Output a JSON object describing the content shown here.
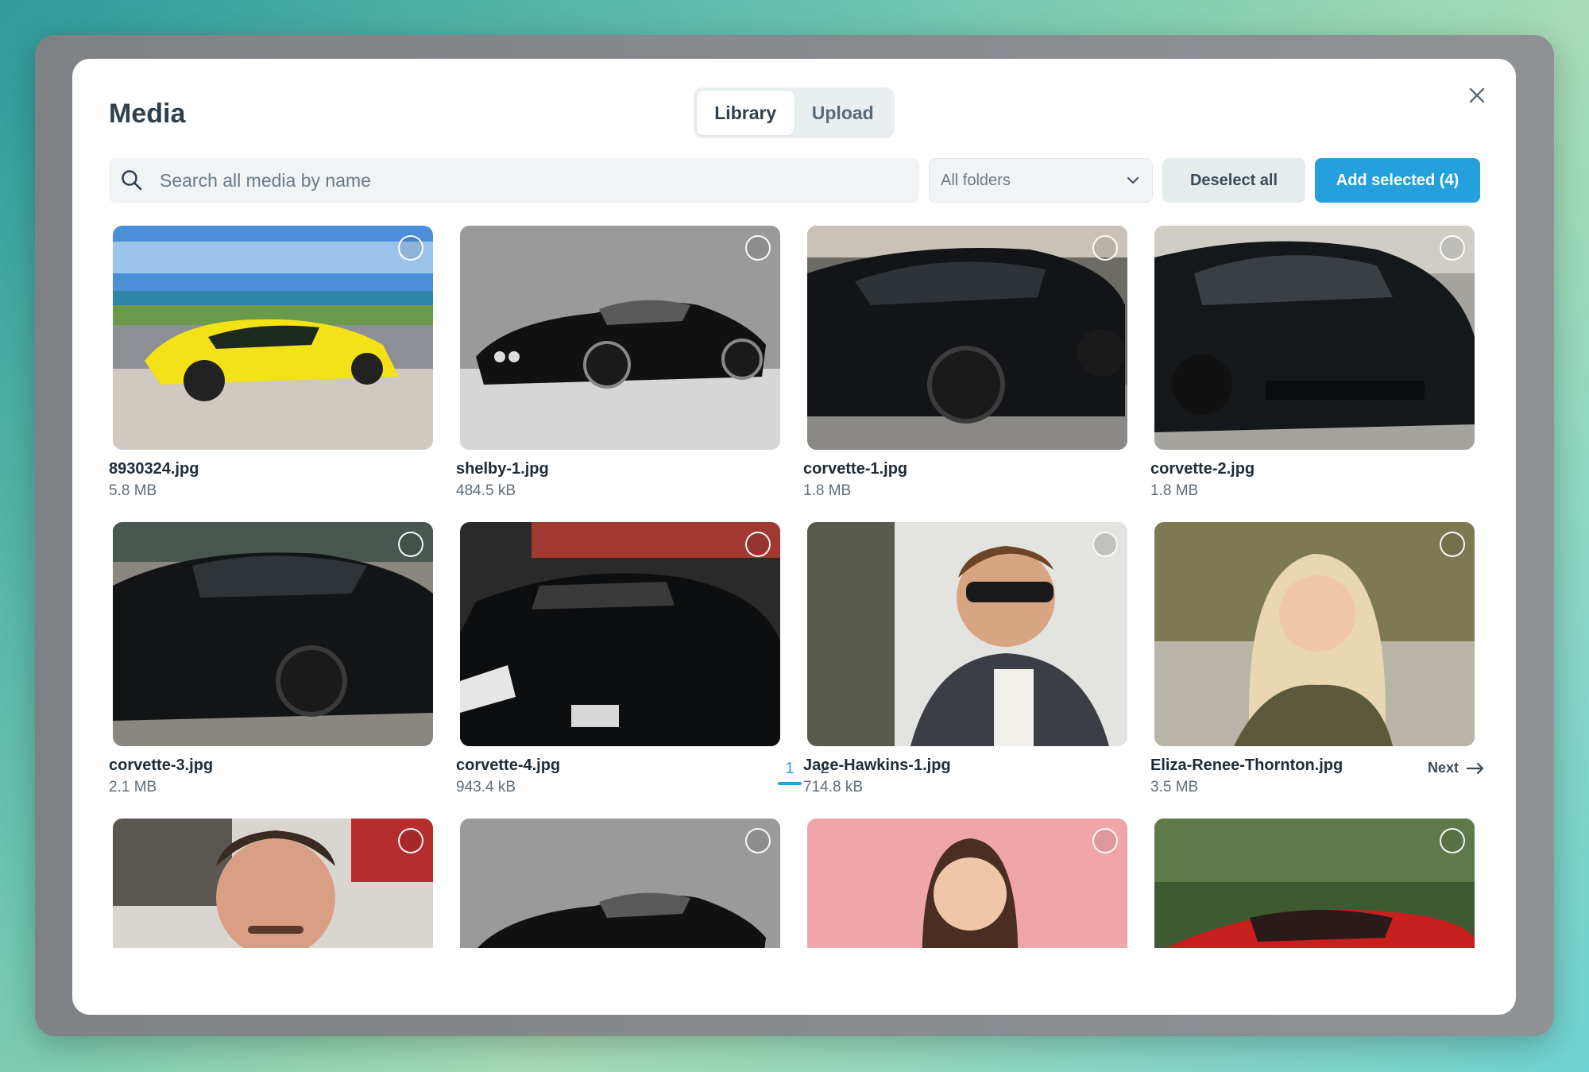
{
  "modal": {
    "title": "Media",
    "tabs": [
      {
        "label": "Library",
        "active": true
      },
      {
        "label": "Upload",
        "active": false
      }
    ]
  },
  "toolbar": {
    "search_placeholder": "Search all media by name",
    "folder_select": "All folders",
    "deselect_label": "Deselect all",
    "add_label": "Add selected (4)"
  },
  "media": [
    {
      "name": "8930324.jpg",
      "size": "5.8 MB"
    },
    {
      "name": "shelby-1.jpg",
      "size": "484.5 kB"
    },
    {
      "name": "corvette-1.jpg",
      "size": "1.8 MB"
    },
    {
      "name": "corvette-2.jpg",
      "size": "1.8 MB"
    },
    {
      "name": "corvette-3.jpg",
      "size": "2.1 MB"
    },
    {
      "name": "corvette-4.jpg",
      "size": "943.4 kB"
    },
    {
      "name": "Jace-Hawkins-1.jpg",
      "size": "714.8 kB"
    },
    {
      "name": "Eliza-Renee-Thornton.jpg",
      "size": "3.5 MB"
    },
    {
      "name": "",
      "size": ""
    },
    {
      "name": "",
      "size": ""
    },
    {
      "name": "",
      "size": ""
    },
    {
      "name": "",
      "size": ""
    }
  ],
  "pagination": {
    "pages": [
      "1",
      "2"
    ],
    "current": "1",
    "next_label": "Next"
  },
  "colors": {
    "accent": "#24a0dc",
    "title": "#2f3f4c"
  }
}
